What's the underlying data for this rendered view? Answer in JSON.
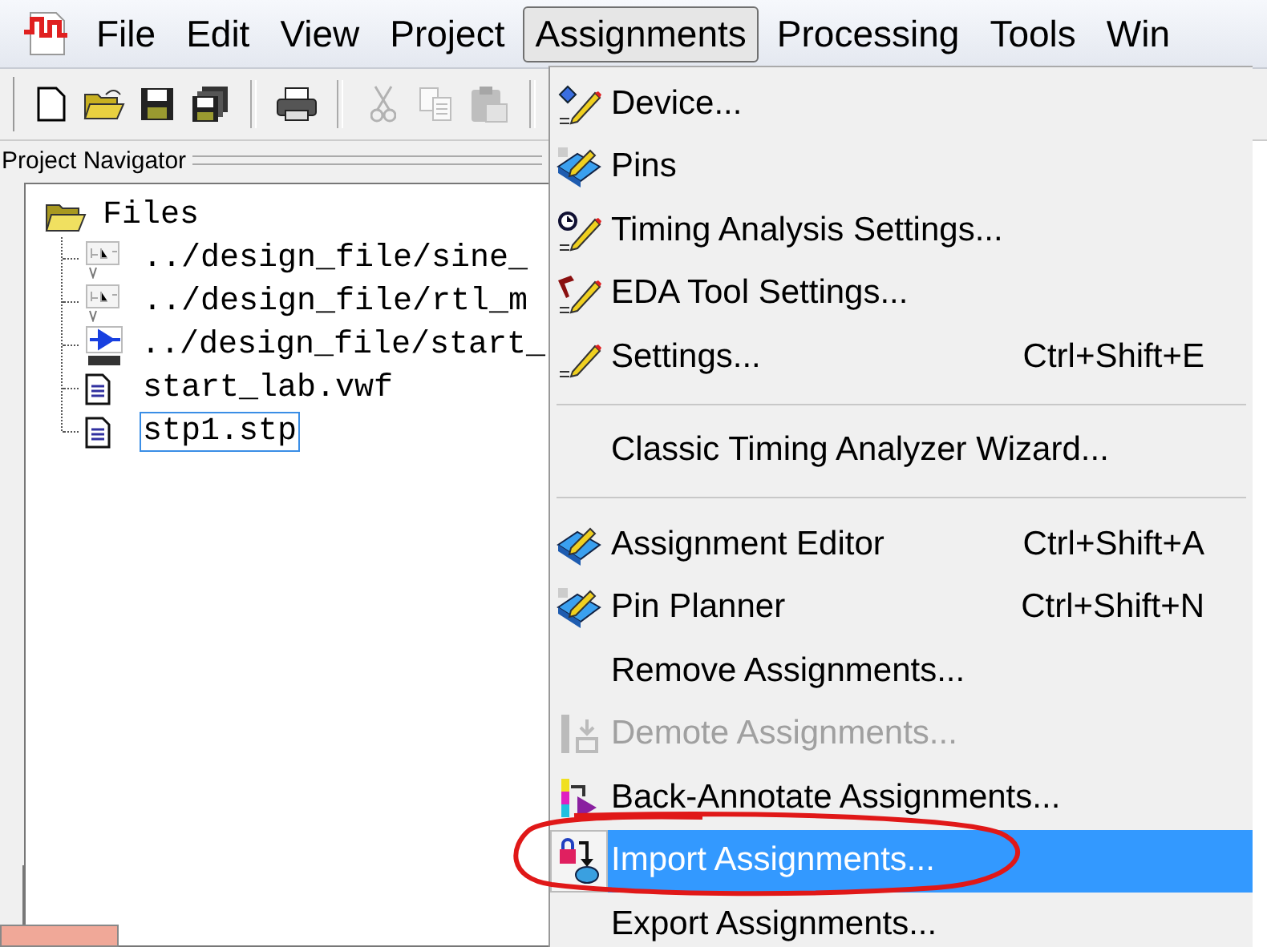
{
  "menubar": {
    "items": [
      {
        "label": "File",
        "selected": false
      },
      {
        "label": "Edit",
        "selected": false
      },
      {
        "label": "View",
        "selected": false
      },
      {
        "label": "Project",
        "selected": false
      },
      {
        "label": "Assignments",
        "selected": true
      },
      {
        "label": "Processing",
        "selected": false
      },
      {
        "label": "Tools",
        "selected": false
      },
      {
        "label": "Win",
        "selected": false
      }
    ]
  },
  "toolbar": {
    "buttons": [
      {
        "kind": "button",
        "disabled": false
      },
      {
        "kind": "button",
        "disabled": false
      },
      {
        "kind": "button",
        "disabled": false
      },
      {
        "kind": "button",
        "disabled": false
      },
      {
        "kind": "separator"
      },
      {
        "kind": "button",
        "disabled": false
      },
      {
        "kind": "separator"
      },
      {
        "kind": "button",
        "disabled": true
      },
      {
        "kind": "button",
        "disabled": true
      },
      {
        "kind": "button",
        "disabled": true
      },
      {
        "kind": "separator"
      }
    ]
  },
  "navigator": {
    "title": "Project Navigator",
    "tree": [
      {
        "label": "Files",
        "expanded": true,
        "selected": false,
        "children": [
          {
            "label": "../design_file/sine_",
            "selected": false
          },
          {
            "label": "../design_file/rtl_m",
            "selected": false
          },
          {
            "label": "../design_file/start_",
            "selected": false
          },
          {
            "label": "start_lab.vwf",
            "selected": false
          },
          {
            "label": "stp1.stp",
            "selected": true
          }
        ]
      }
    ]
  },
  "menu": {
    "items": [
      {
        "kind": "item",
        "label": "Device...",
        "disabled": false,
        "selected": false
      },
      {
        "kind": "item",
        "label": "Pins",
        "disabled": false,
        "selected": false
      },
      {
        "kind": "item",
        "label": "Timing Analysis Settings...",
        "disabled": false,
        "selected": false
      },
      {
        "kind": "item",
        "label": "EDA Tool Settings...",
        "disabled": false,
        "selected": false
      },
      {
        "kind": "item",
        "label": "Settings...",
        "shortcut": "Ctrl+Shift+E",
        "disabled": false,
        "selected": false
      },
      {
        "kind": "separator"
      },
      {
        "kind": "item",
        "label": "Classic Timing Analyzer Wizard...",
        "disabled": false,
        "selected": false
      },
      {
        "kind": "separator"
      },
      {
        "kind": "item",
        "label": "Assignment Editor",
        "shortcut": "Ctrl+Shift+A",
        "disabled": false,
        "selected": false
      },
      {
        "kind": "item",
        "label": "Pin Planner",
        "shortcut": "Ctrl+Shift+N",
        "disabled": false,
        "selected": false
      },
      {
        "kind": "item",
        "label": "Remove Assignments...",
        "disabled": false,
        "selected": false
      },
      {
        "kind": "item",
        "label": "Demote Assignments...",
        "disabled": true,
        "selected": false
      },
      {
        "kind": "item",
        "label": "Back-Annotate Assignments...",
        "disabled": false,
        "selected": false
      },
      {
        "kind": "item",
        "label": "Import Assignments...",
        "disabled": false,
        "selected": true
      },
      {
        "kind": "item",
        "label": "Export Assignments...",
        "disabled": false,
        "selected": false
      }
    ]
  }
}
